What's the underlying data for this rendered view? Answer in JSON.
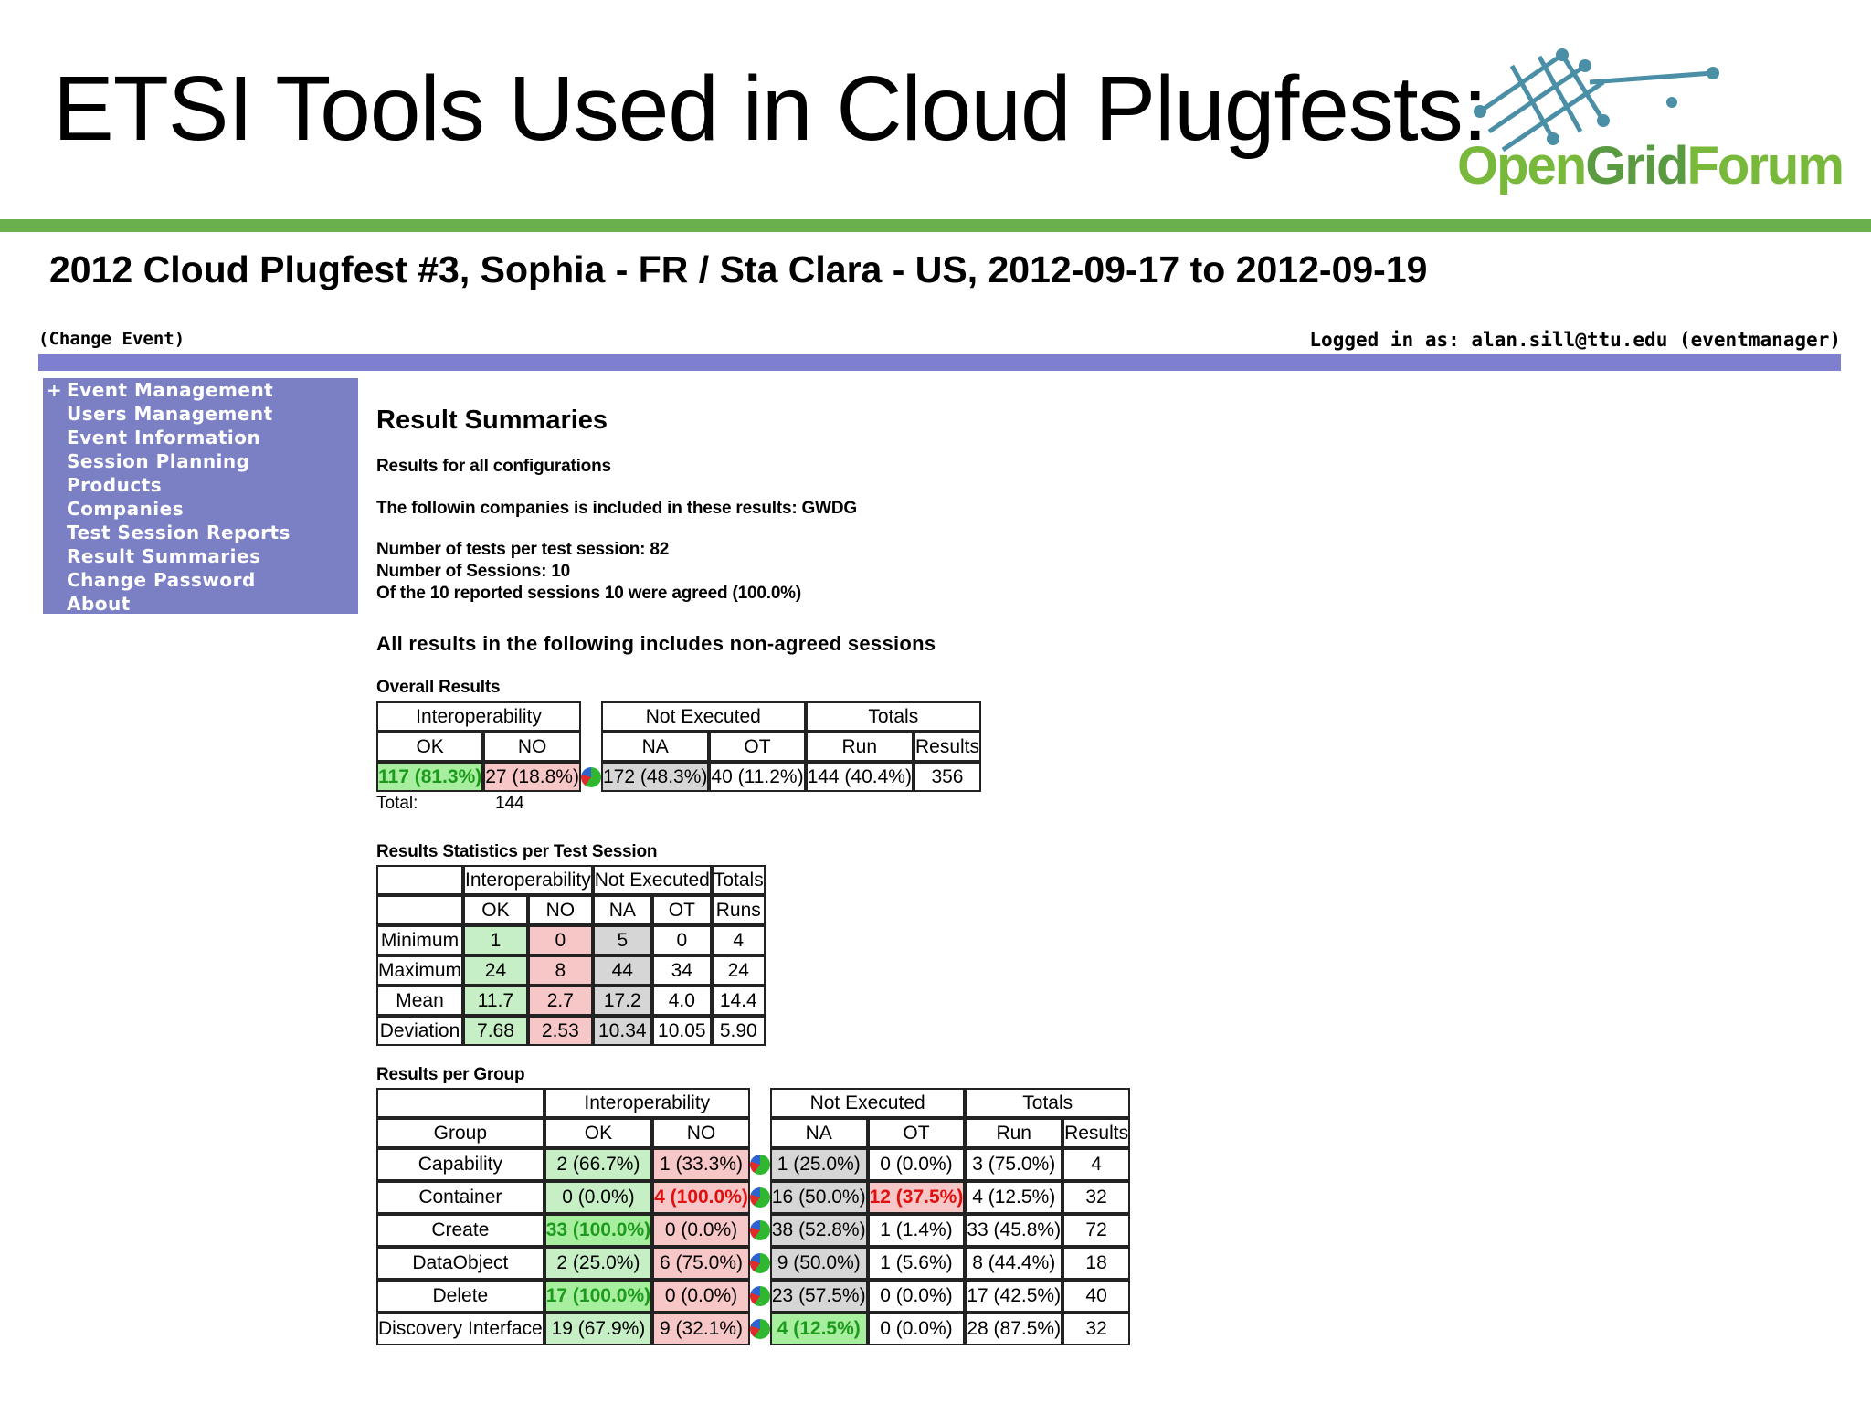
{
  "slide": {
    "title": "ETSI Tools Used in Cloud Plugfests:",
    "logo": {
      "open": "Open",
      "grid": "Grid",
      "forum": "Forum"
    },
    "accent_color": "#6ab04c"
  },
  "app": {
    "event_title": "2012 Cloud Plugfest #3, Sophia - FR / Sta Clara - US, 2012-09-17 to 2012-09-19",
    "change_event": "(Change Event)",
    "logged_in": "Logged in as: alan.sill@ttu.edu (eventmanager)",
    "sidebar": {
      "expand_glyph": "+",
      "items": [
        "Event Management",
        "Users Management",
        "Event Information",
        "Session Planning",
        "Products",
        "Companies",
        "Test Session Reports",
        "Result Summaries",
        "Change Password",
        "About"
      ]
    }
  },
  "main": {
    "heading": "Result Summaries",
    "results_for": "Results for all configurations",
    "companies": "The followin companies is included in these results: GWDG",
    "tests_per_session": "Number of tests per test session: 82",
    "num_sessions": "Number of Sessions: 10",
    "agreed": "Of the 10 reported sessions 10 were agreed (100.0%)",
    "non_agreed_note": "All results in the following includes non-agreed sessions",
    "overall": {
      "title": "Overall Results",
      "headers": {
        "interop": "Interoperability",
        "not_executed": "Not Executed",
        "totals": "Totals",
        "ok": "OK",
        "no": "NO",
        "na": "NA",
        "ot": "OT",
        "run": "Run",
        "results": "Results"
      },
      "ok": "117 (81.3%)",
      "no": "27 (18.8%)",
      "na": "172 (48.3%)",
      "ot": "40 (11.2%)",
      "run": "144 (40.4%)",
      "results": "356",
      "total_label": "Total:",
      "total_value": "144"
    },
    "stats": {
      "title": "Results Statistics per Test Session",
      "headers": {
        "interop": "Interoperability",
        "not_executed": "Not Executed",
        "totals": "Totals",
        "ok": "OK",
        "no": "NO",
        "na": "NA",
        "ot": "OT",
        "runs": "Runs"
      },
      "rows": [
        {
          "label": "Minimum",
          "ok": "1",
          "no": "0",
          "na": "5",
          "ot": "0",
          "runs": "4"
        },
        {
          "label": "Maximum",
          "ok": "24",
          "no": "8",
          "na": "44",
          "ot": "34",
          "runs": "24"
        },
        {
          "label": "Mean",
          "ok": "11.7",
          "no": "2.7",
          "na": "17.2",
          "ot": "4.0",
          "runs": "14.4"
        },
        {
          "label": "Deviation",
          "ok": "7.68",
          "no": "2.53",
          "na": "10.34",
          "ot": "10.05",
          "runs": "5.90"
        }
      ]
    },
    "groups": {
      "title": "Results per Group",
      "headers": {
        "group": "Group",
        "interop": "Interoperability",
        "not_executed": "Not Executed",
        "totals": "Totals",
        "ok": "OK",
        "no": "NO",
        "na": "NA",
        "ot": "OT",
        "run": "Run",
        "results": "Results"
      },
      "rows": [
        {
          "group": "Capability",
          "ok": "2 (66.7%)",
          "no": "1 (33.3%)",
          "na": "1 (25.0%)",
          "ot": "0 (0.0%)",
          "run": "3 (75.0%)",
          "results": "4"
        },
        {
          "group": "Container",
          "ok": "0 (0.0%)",
          "no": "4 (100.0%)",
          "na": "16 (50.0%)",
          "ot": "12 (37.5%)",
          "run": "4 (12.5%)",
          "results": "32"
        },
        {
          "group": "Create",
          "ok": "33 (100.0%)",
          "no": "0 (0.0%)",
          "na": "38 (52.8%)",
          "ot": "1 (1.4%)",
          "run": "33 (45.8%)",
          "results": "72"
        },
        {
          "group": "DataObject",
          "ok": "2 (25.0%)",
          "no": "6 (75.0%)",
          "na": "9 (50.0%)",
          "ot": "1 (5.6%)",
          "run": "8 (44.4%)",
          "results": "18"
        },
        {
          "group": "Delete",
          "ok": "17 (100.0%)",
          "no": "0 (0.0%)",
          "na": "23 (57.5%)",
          "ot": "0 (0.0%)",
          "run": "17 (42.5%)",
          "results": "40"
        },
        {
          "group": "Discovery Interface",
          "ok": "19 (67.9%)",
          "no": "9 (32.1%)",
          "na": "4 (12.5%)",
          "ot": "0 (0.0%)",
          "run": "28 (87.5%)",
          "results": "32"
        }
      ]
    }
  }
}
